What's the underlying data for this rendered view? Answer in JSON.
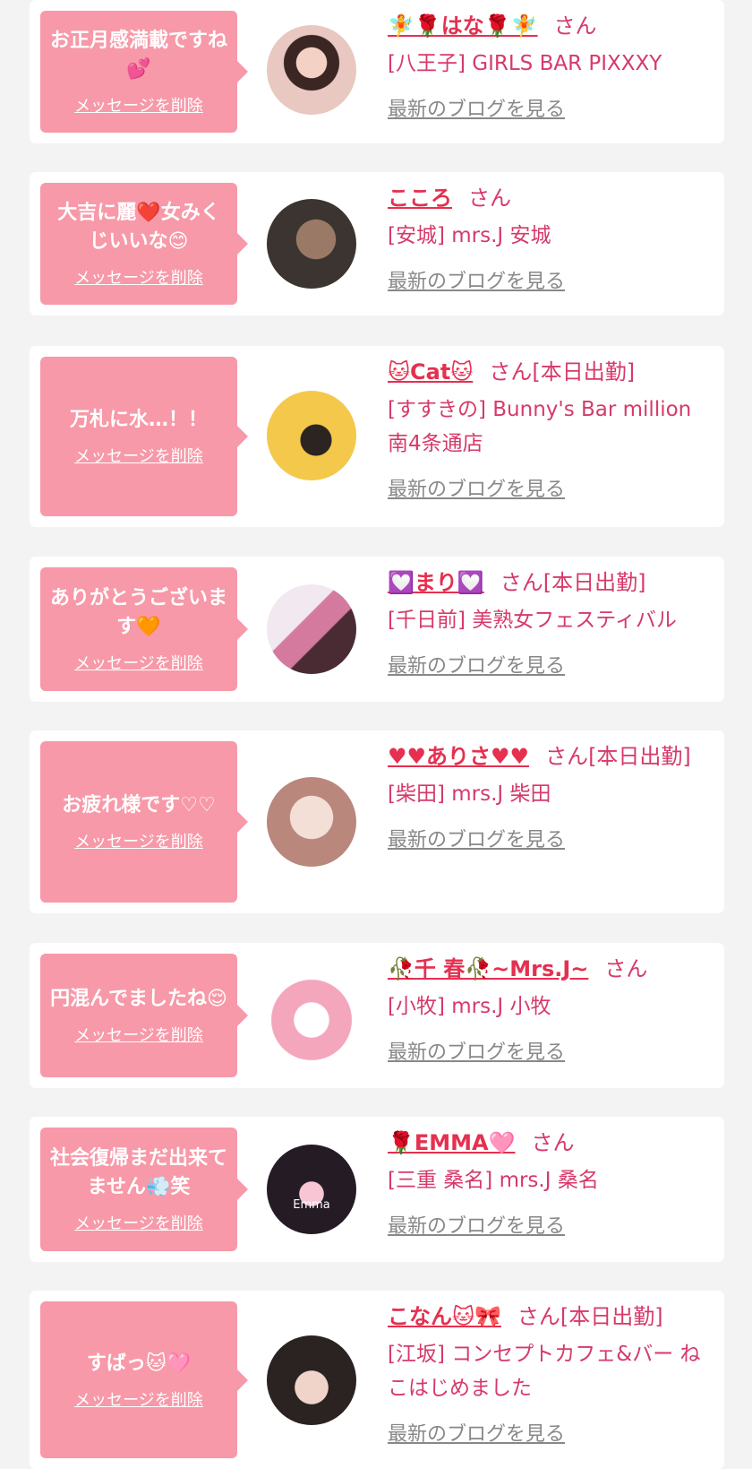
{
  "delete_label": "メッセージを削除",
  "blog_label": "最新のブログを見る",
  "san_label": "さん",
  "cards": [
    {
      "message": "お正月感満載ですね💕",
      "name": "🧚🌹はな🌹🧚",
      "status": "",
      "shop": "[八王子] GIRLS BAR PIXXXY"
    },
    {
      "message": "大吉に麗❤️女みくじいいな😊",
      "name": "こころ",
      "status": "",
      "shop": "[安城] mrs.J 安城"
    },
    {
      "message": "万札に水…！！",
      "name": "🐱Cat🐱",
      "status": "[本日出勤]",
      "shop": "[すすきの] Bunny's Bar million 南4条通店"
    },
    {
      "message": "ありがとうございます🧡",
      "name": "💟まり💟",
      "status": "[本日出勤]",
      "shop": "[千日前] 美熟女フェスティバル"
    },
    {
      "message": "お疲れ様です♡♡",
      "name": "♥♥ありさ♥♥",
      "status": "[本日出勤]",
      "shop": "[柴田] mrs.J 柴田"
    },
    {
      "message": "円混んでましたね😌",
      "name": "🥀千 春🥀~Mrs.J~",
      "status": "",
      "shop": "[小牧] mrs.J 小牧"
    },
    {
      "message": "社会復帰まだ出来てません💨笑",
      "name": "🌹EMMA🩷",
      "status": "",
      "shop": "[三重 桑名] mrs.J 桑名"
    },
    {
      "message": "すばっ🐱🩷",
      "name": "こなん🐱🎀",
      "status": "[本日出勤]",
      "shop": "[江坂] コンセプトカフェ&バー ねこはじめました"
    }
  ],
  "avatar_texts": {
    "emma": "Emma"
  }
}
